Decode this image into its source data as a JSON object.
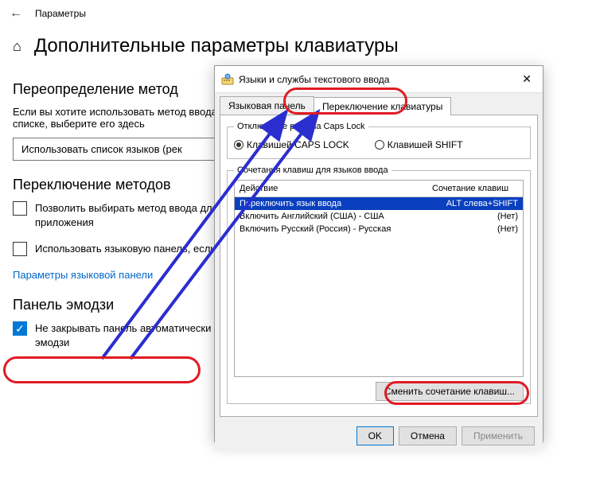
{
  "header": {
    "settings_label": "Параметры"
  },
  "page": {
    "title": "Дополнительные параметры клавиатуры"
  },
  "sections": {
    "override": {
      "heading": "Переопределение метод",
      "desc": "Если вы хотите использовать метод ввода, отличный от первого в списке, выберите его здесь",
      "dropdown": "Использовать список языков (рек"
    },
    "switching": {
      "heading": "Переключение методов",
      "opt1": "Позволить выбирать метод ввода для каждого приложения",
      "opt2": "Использовать языковую панель, если она доступна",
      "link": "Параметры языковой панели"
    },
    "emoji": {
      "heading": "Панель эмодзи",
      "opt": "Не закрывать панель автоматически после ввода эмодзи"
    }
  },
  "dialog": {
    "title": "Языки и службы текстового ввода",
    "tabs": {
      "lang_panel": "Языковая панель",
      "kb_switch": "Переключение клавиатуры"
    },
    "caps": {
      "legend": "Отключение режима Caps Lock",
      "radio_caps": "Клавишей CAPS LOCK",
      "radio_shift": "Клавишей SHIFT"
    },
    "hotkeys": {
      "legend": "Сочетания клавиш для языков ввода",
      "col_action": "Действие",
      "col_keys": "Сочетание клавиш",
      "rows": [
        {
          "action": "Переключить язык ввода",
          "keys": "ALT слева+SHIFT",
          "selected": true
        },
        {
          "action": "Включить Английский (США) - США",
          "keys": "(Нет)",
          "selected": false
        },
        {
          "action": "Включить Русский (Россия) - Русская",
          "keys": "(Нет)",
          "selected": false
        }
      ],
      "change_btn": "Сменить сочетание клавиш..."
    },
    "buttons": {
      "ok": "OK",
      "cancel": "Отмена",
      "apply": "Применить"
    }
  }
}
